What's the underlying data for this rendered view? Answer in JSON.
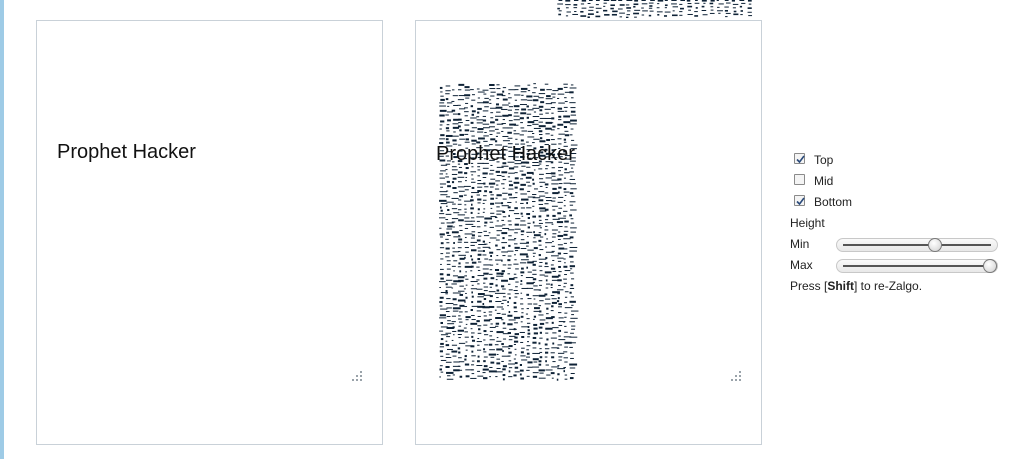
{
  "input_box": {
    "text": "Prophet Hacker"
  },
  "output_box": {
    "text": "Prophet Hacker"
  },
  "options": [
    {
      "label": "Top",
      "checked": true
    },
    {
      "label": "Mid",
      "checked": false
    },
    {
      "label": "Bottom",
      "checked": true
    }
  ],
  "height": {
    "label": "Height",
    "min": {
      "label": "Min",
      "value": 0.62
    },
    "max": {
      "label": "Max",
      "value": 1.0
    }
  },
  "hint": {
    "prefix": "Press [",
    "key": "Shift",
    "suffix": "] to re-Zalgo."
  },
  "colors": {
    "accent_strip": "#9ecbe6",
    "box_border": "#c9d1d8",
    "zalgo_ink": "#0e2236"
  },
  "icons": {
    "resize_grip": "resize-grip-icon",
    "checkmark": "checkmark-icon"
  }
}
